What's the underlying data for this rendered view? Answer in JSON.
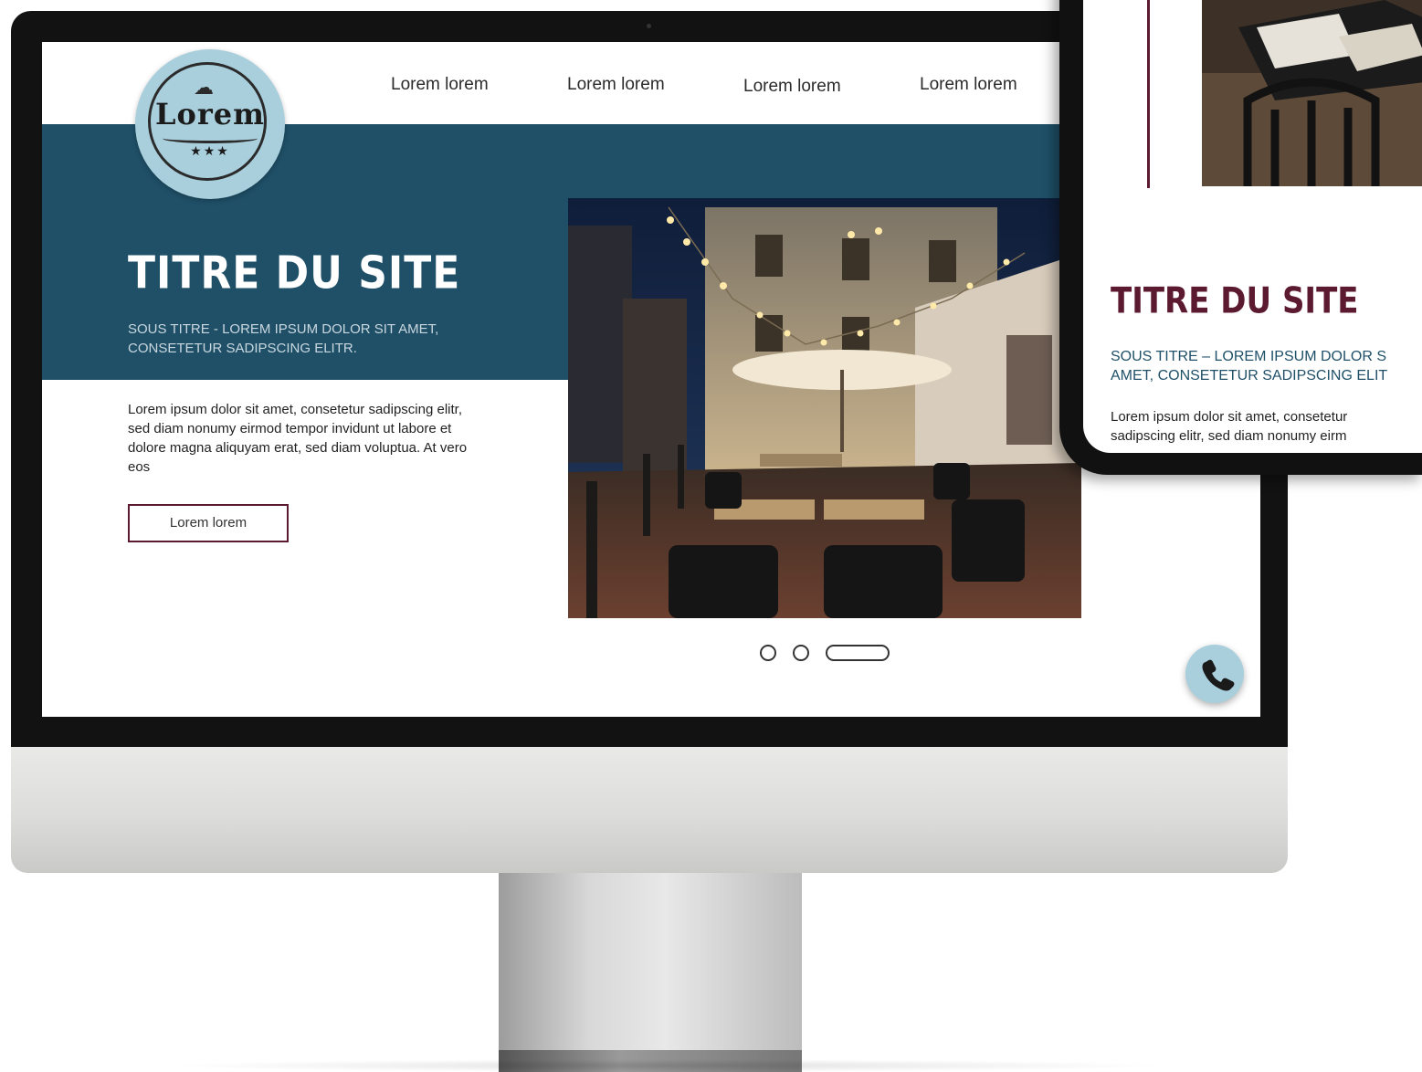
{
  "desktop": {
    "logo": {
      "text": "Lorem",
      "stars": "★★★"
    },
    "nav": {
      "items": [
        {
          "label": "Lorem lorem"
        },
        {
          "label": "Lorem lorem"
        },
        {
          "label": "Lorem lorem"
        },
        {
          "label": "Lorem lorem"
        }
      ]
    },
    "hero": {
      "title": "TITRE DU SITE",
      "subtitle": "SOUS TITRE - LOREM IPSUM DOLOR SIT AMET, CONSETETUR SADIPSCING ELITR.",
      "body": "Lorem ipsum dolor sit amet, consetetur sadipscing elitr, sed diam nonumy eirmod tempor invidunt ut labore et dolore magna aliquyam erat, sed diam voluptua. At vero eos",
      "button_label": "Lorem lorem"
    },
    "carousel": {
      "slides": 3,
      "active_index": 2
    },
    "call_button": {
      "icon": "phone-icon"
    }
  },
  "mobile": {
    "title": "TITRE DU SITE",
    "subtitle_line1": "SOUS TITRE – LOREM IPSUM DOLOR S",
    "subtitle_line2": "AMET, CONSETETUR SADIPSCING ELIT",
    "body_line1": "Lorem ipsum dolor sit amet, consetetur",
    "body_line2": "sadipscing elitr, sed diam nonumy eirm"
  },
  "colors": {
    "accent_blue": "#1f5068",
    "logo_blue": "#a9cfdd",
    "burgundy": "#5b1a2f"
  }
}
